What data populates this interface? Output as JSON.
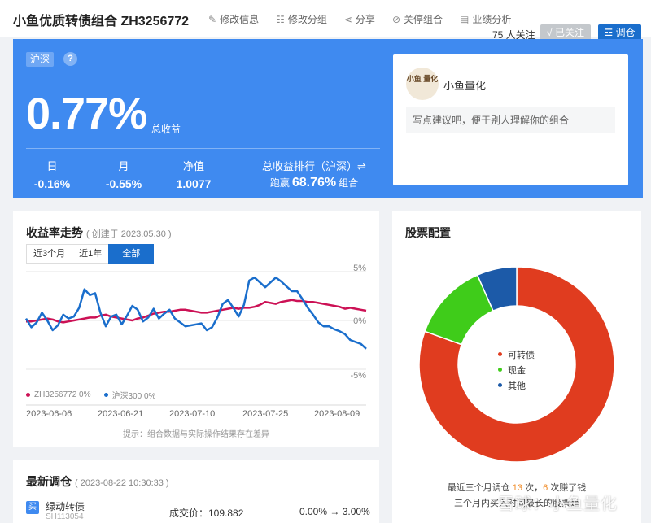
{
  "header": {
    "title": "小鱼优质转债组合 ZH3256772",
    "actions": [
      {
        "icon": "pencil-icon",
        "glyph": "✎",
        "label": "修改信息"
      },
      {
        "icon": "list-icon",
        "glyph": "☷",
        "label": "修改分组"
      },
      {
        "icon": "share-icon",
        "glyph": "⋖",
        "label": "分享"
      },
      {
        "icon": "block-icon",
        "glyph": "⊘",
        "label": "关停组合"
      },
      {
        "icon": "report-icon",
        "glyph": "▤",
        "label": "业绩分析"
      }
    ],
    "follow_count": "75 人关注",
    "followed_button": "√ 已关注",
    "adjust_button": "☲ 调仓"
  },
  "banner": {
    "market_tag": "沪深",
    "help": "?",
    "total_return": "0.77%",
    "total_return_label": "总收益",
    "stats": [
      {
        "label": "日",
        "value": "-0.16%"
      },
      {
        "label": "月",
        "value": "-0.55%"
      },
      {
        "label": "净值",
        "value": "1.0077"
      }
    ],
    "rank_label": "总收益排行（沪深）⇌",
    "rank_prefix": "跑赢",
    "rank_value": "68.76%",
    "rank_suffix": "组合",
    "color": "#3f8af0"
  },
  "owner": {
    "avatar_text": "小鱼 量化",
    "name": "小鱼量化",
    "description_placeholder": "写点建议吧，便于别人理解你的组合"
  },
  "trend": {
    "title": "收益率走势",
    "created": "( 创建于 2023.05.30 )",
    "tabs": [
      "近3个月",
      "近1年",
      "全部"
    ],
    "active_tab": 2,
    "note": "提示：组合数据与实际操作结果存在差异"
  },
  "chart_data": {
    "type": "line",
    "ylim": [
      -5,
      5
    ],
    "y_ticks": [
      "5%",
      "0%",
      "-5%"
    ],
    "x_ticks": [
      "2023-06-06",
      "2023-06-21",
      "2023-07-10",
      "2023-07-25",
      "2023-08-09"
    ],
    "legend": [
      {
        "name": "ZH3256772 0%",
        "color": "#cc1155"
      },
      {
        "name": "沪深300 0%",
        "color": "#1a6ecc"
      }
    ],
    "series": [
      {
        "name": "ZH3256772",
        "color": "#cc1155",
        "values": [
          -0.1,
          -0.1,
          0.0,
          0.1,
          0.2,
          0.1,
          -0.1,
          -0.2,
          -0.1,
          0.0,
          0.1,
          0.2,
          0.3,
          0.3,
          0.5,
          0.6,
          0.4,
          0.3,
          0.2,
          0.1,
          0.0,
          0.2,
          0.3,
          0.5,
          0.7,
          0.8,
          0.9,
          0.9,
          1.0,
          1.1,
          1.1,
          1.0,
          0.9,
          0.8,
          0.8,
          0.9,
          1.0,
          1.1,
          1.2,
          1.3,
          1.2,
          1.3,
          1.3,
          1.4,
          1.6,
          1.9,
          1.8,
          1.7,
          1.9,
          2.0,
          2.1,
          2.0,
          2.0,
          1.9,
          1.9,
          1.8,
          1.7,
          1.6,
          1.5,
          1.4,
          1.2,
          1.3,
          1.2,
          1.1,
          1.0
        ]
      },
      {
        "name": "沪深300",
        "color": "#1a6ecc",
        "values": [
          0.2,
          -0.7,
          -0.2,
          0.8,
          0.0,
          -1.0,
          -0.5,
          0.6,
          0.2,
          0.4,
          1.3,
          3.2,
          2.6,
          2.8,
          0.8,
          -0.6,
          0.4,
          0.6,
          -0.4,
          0.5,
          1.5,
          1.1,
          -0.1,
          0.3,
          1.2,
          0.2,
          0.7,
          1.1,
          0.2,
          -0.2,
          -0.6,
          -0.5,
          -0.4,
          -0.3,
          -1.0,
          -0.7,
          0.3,
          1.7,
          2.1,
          1.3,
          0.4,
          1.6,
          4.1,
          4.4,
          3.9,
          3.4,
          3.9,
          4.4,
          4.0,
          3.5,
          3.0,
          3.0,
          2.2,
          1.3,
          0.6,
          -0.2,
          -0.6,
          -0.6,
          -0.9,
          -1.1,
          -1.4,
          -2.0,
          -2.2,
          -2.4,
          -2.9
        ]
      }
    ]
  },
  "allocation": {
    "title": "股票配置",
    "slices": [
      {
        "name": "可转债",
        "value": 80.5,
        "color": "#e03c1f"
      },
      {
        "name": "现金",
        "value": 12.9,
        "color": "#3fcc1a"
      },
      {
        "name": "其他",
        "value": 6.6,
        "color": "#1c5aa8"
      }
    ],
    "footer_line1": {
      "pre": "最近三个月调仓",
      "n1": "13",
      "mid": "次，",
      "n2": "6",
      "post": "次赚了钱"
    },
    "footer_line2": "三个月内买入时间最长的股票是"
  },
  "latest": {
    "title": "最新调仓",
    "time": "( 2023-08-22 10:30:33 )",
    "trade": {
      "badge": "买",
      "name": "绿动转债",
      "code": "SH113054",
      "price_label": "成交价：109.882",
      "from": "0.00%",
      "arrow": "→",
      "to": "3.00%"
    }
  },
  "watermark": "雪球：小鱼量化"
}
